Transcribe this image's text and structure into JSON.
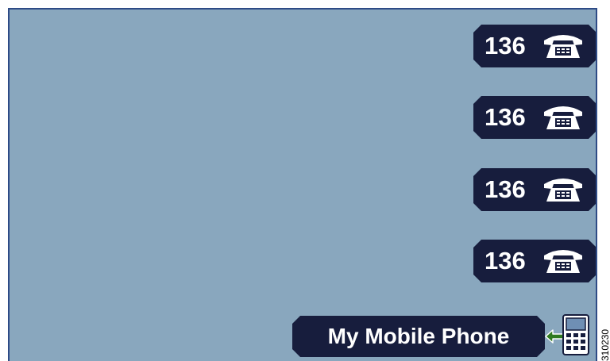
{
  "line_keys": [
    {
      "number": "136",
      "icon": "desk-phone-icon"
    },
    {
      "number": "136",
      "icon": "desk-phone-icon"
    },
    {
      "number": "136",
      "icon": "desk-phone-icon"
    },
    {
      "number": "136",
      "icon": "desk-phone-icon"
    }
  ],
  "mobile_key": {
    "label": "My Mobile Phone",
    "arrow_icon": "arrow-left-icon",
    "device_icon": "mobile-phone-icon"
  },
  "figure_ref": "310230",
  "colors": {
    "screen_background": "#89a7be",
    "screen_border": "#2e4b86",
    "key_background": "#171d3d",
    "key_text": "#ffffff",
    "arrow": "#2f7a1f"
  }
}
